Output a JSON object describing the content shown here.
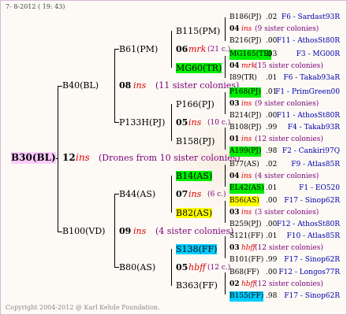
{
  "header": {
    "date": "7- 8-2012 ( 19: 43)"
  },
  "footer": {
    "copyright": "Copyright 2004-2012 @ Karl Kehde Foundation."
  },
  "root": {
    "name": "B30(BL)",
    "num": "12",
    "ins": "ins",
    "note": "(Drones from 10 sister colonies)"
  },
  "gen1": [
    {
      "name": "B40(BL)",
      "num": "08",
      "ins": "ins",
      "note": "(11 sister colonies)"
    },
    {
      "name": "B100(VD)",
      "num": "09",
      "ins": "ins",
      "note": "(4 sister colonies)"
    }
  ],
  "gen2": [
    {
      "name": "B61(PM)",
      "num": "06",
      "ins": "mrk",
      "note": "(21 c.)"
    },
    {
      "name": "P133H(PJ)",
      "num": "05",
      "ins": "ins",
      "note": "(10 c.)"
    },
    {
      "name": "B44(AS)",
      "num": "07",
      "ins": "ins",
      "note": "(6 c.)"
    },
    {
      "name": "B80(AS)",
      "num": "05",
      "ins": "hbff",
      "note": "(12 c.)"
    }
  ],
  "gen3": [
    {
      "name": "B115(PM)"
    },
    {
      "name": "MG60(TR)"
    },
    {
      "name": "P166(PJ)"
    },
    {
      "name": "B158(PJ)"
    },
    {
      "name": "B14(AS)"
    },
    {
      "name": "B82(AS)"
    },
    {
      "name": "S138(FF)"
    },
    {
      "name": "B363(FF)"
    }
  ],
  "gen4": [
    {
      "a": "B186(PJ)",
      "av": ".02",
      "an": "F6 - Sardast93R",
      "num": "04",
      "ins": "ins",
      "sis": "(9 sister colonies)",
      "b": "B216(PJ)",
      "bv": ".00",
      "bn": "F11 - AthosSt80R"
    },
    {
      "a": "MG165(TR)",
      "av": ".03",
      "an": "F3 - MG00R",
      "num": "04",
      "ins": "mrk",
      "sis": "(15 sister colonies)",
      "b": "I89(TR)",
      "bv": ".01",
      "bn": "F6 - Takab93aR"
    },
    {
      "a": "P168(PJ)",
      "av": ".01",
      "an": "F1 - PrimGreen00",
      "num": "03",
      "ins": "ins",
      "sis": "(9 sister colonies)",
      "b": "B214(PJ)",
      "bv": ".00",
      "bn": "F11 - AthosSt80R"
    },
    {
      "a": "B108(PJ)",
      "av": ".99",
      "an": "F4 - Takab93R",
      "num": "01",
      "ins": "ins",
      "sis": "(12 sister colonies)",
      "b": "A199(PJ)",
      "bv": ".98",
      "bn": "F2 - Cankiri97Q"
    },
    {
      "a": "B77(AS)",
      "av": ".02",
      "an": "F9 - Atlas85R",
      "num": "04",
      "ins": "ins",
      "sis": "(4 sister colonies)",
      "b": "EL42(AS)",
      "bv": ".01",
      "bn": "F1 - EO520"
    },
    {
      "a": "B56(AS)",
      "av": ".00",
      "an": "F17 - Sinop62R",
      "num": "03",
      "ins": "ins",
      "sis": "(3 sister colonies)",
      "b": "B259(PJ)",
      "bv": ".00",
      "bn": "F12 - AthosSt80R"
    },
    {
      "a": "S121(FF)",
      "av": ".01",
      "an": "F10 - Atlas85R",
      "num": "03",
      "ins": "hbff",
      "sis": "(12 sister colonies)",
      "b": "B101(FF)",
      "bv": ".99",
      "bn": "F17 - Sinop62R"
    },
    {
      "a": "B68(FF)",
      "av": ".00",
      "an": "F12 - Longos77R",
      "num": "02",
      "ins": "hbff",
      "sis": "(12 sister colonies)",
      "b": "B155(FF)",
      "bv": ".98",
      "bn": "F17 - Sinop62R"
    }
  ],
  "colors": {
    "green": "#00ee00",
    "yellow": "#ffff00",
    "cyan": "#00ccff",
    "root_bg": "#ffccff"
  }
}
